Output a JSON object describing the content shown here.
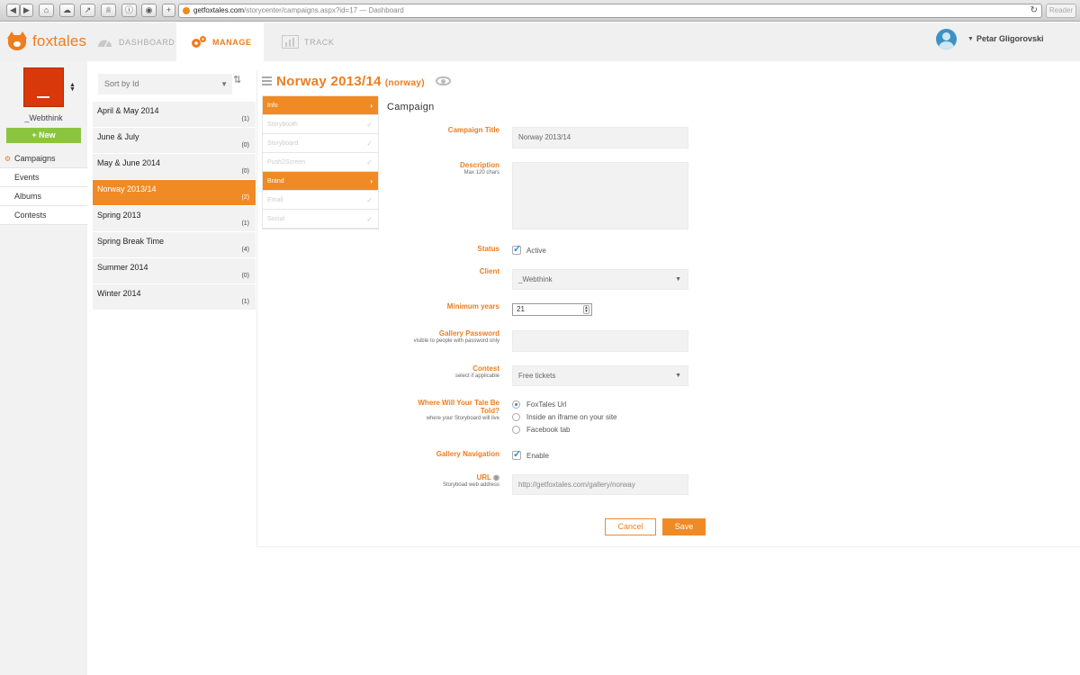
{
  "browser": {
    "url_host": "getfoxtales.com",
    "url_path": "/storycenter/campaigns.aspx?id=17",
    "page_title": "— Dashboard",
    "reader_label": "Reader"
  },
  "app": {
    "brand": "foxtales",
    "accent": "#f08a24",
    "tabs": [
      {
        "label": "DASHBOARD",
        "icon": "speedometer-icon"
      },
      {
        "label": "MANAGE",
        "icon": "gears-icon"
      },
      {
        "label": "TRACK",
        "icon": "bar-chart-icon"
      }
    ],
    "user_name": "Petar Gligorovski"
  },
  "sidebar": {
    "company_name": "_Webthink",
    "new_label": "+ New",
    "items": [
      {
        "label": "Campaigns"
      },
      {
        "label": "Events"
      },
      {
        "label": "Albums"
      },
      {
        "label": "Contests"
      }
    ]
  },
  "list": {
    "sort_label": "Sort by Id",
    "campaigns": [
      {
        "name": "April & May 2014",
        "count": "(1)"
      },
      {
        "name": "June & July",
        "count": "(0)"
      },
      {
        "name": "May & June 2014",
        "count": "(0)"
      },
      {
        "name": "Norway 2013/14",
        "count": "(2)"
      },
      {
        "name": "Spring 2013",
        "count": "(1)"
      },
      {
        "name": "Spring Break Time",
        "count": "(4)"
      },
      {
        "name": "Summer 2014",
        "count": "(0)"
      },
      {
        "name": "Winter 2014",
        "count": "(1)"
      }
    ]
  },
  "campaign": {
    "title": "Norway 2013/14",
    "slug": "(norway)",
    "steps": [
      {
        "label": "Info",
        "mark": "›"
      },
      {
        "label": "Storybooth",
        "mark": "✓"
      },
      {
        "label": "Storyboard",
        "mark": "✓"
      },
      {
        "label": "Push2Screen",
        "mark": "✓"
      },
      {
        "label": "Brand",
        "mark": "›"
      },
      {
        "label": "Email",
        "mark": "✓"
      },
      {
        "label": "Social",
        "mark": "✓"
      }
    ],
    "form_heading": "Campaign",
    "fields": {
      "title_label": "Campaign Title",
      "title_value": "Norway 2013/14",
      "description_label": "Description",
      "description_sub": "Max 120 chars",
      "status_label": "Status",
      "status_option": "Active",
      "client_label": "Client",
      "client_value": "_Webthink",
      "min_years_label": "Minimum years",
      "min_years_value": "21",
      "password_label": "Gallery Password",
      "password_sub": "visible to people with password only",
      "contest_label": "Contest",
      "contest_sub": "select if applicable",
      "contest_value": "Free tickets",
      "tale_label_1": "Where Will Your Tale Be",
      "tale_label_2": "Told?",
      "tale_sub": "where your Storyboard will live",
      "tale_options": [
        "FoxTales Url",
        "Inside an iframe on your site",
        "Facebook tab"
      ],
      "gallery_nav_label": "Gallery Navigation",
      "gallery_nav_option": "Enable",
      "url_label": "URL",
      "url_sub": "Storyboad web address",
      "url_placeholder": "http://getfoxtales.com/gallery/norway"
    },
    "cancel_label": "Cancel",
    "save_label": "Save"
  }
}
